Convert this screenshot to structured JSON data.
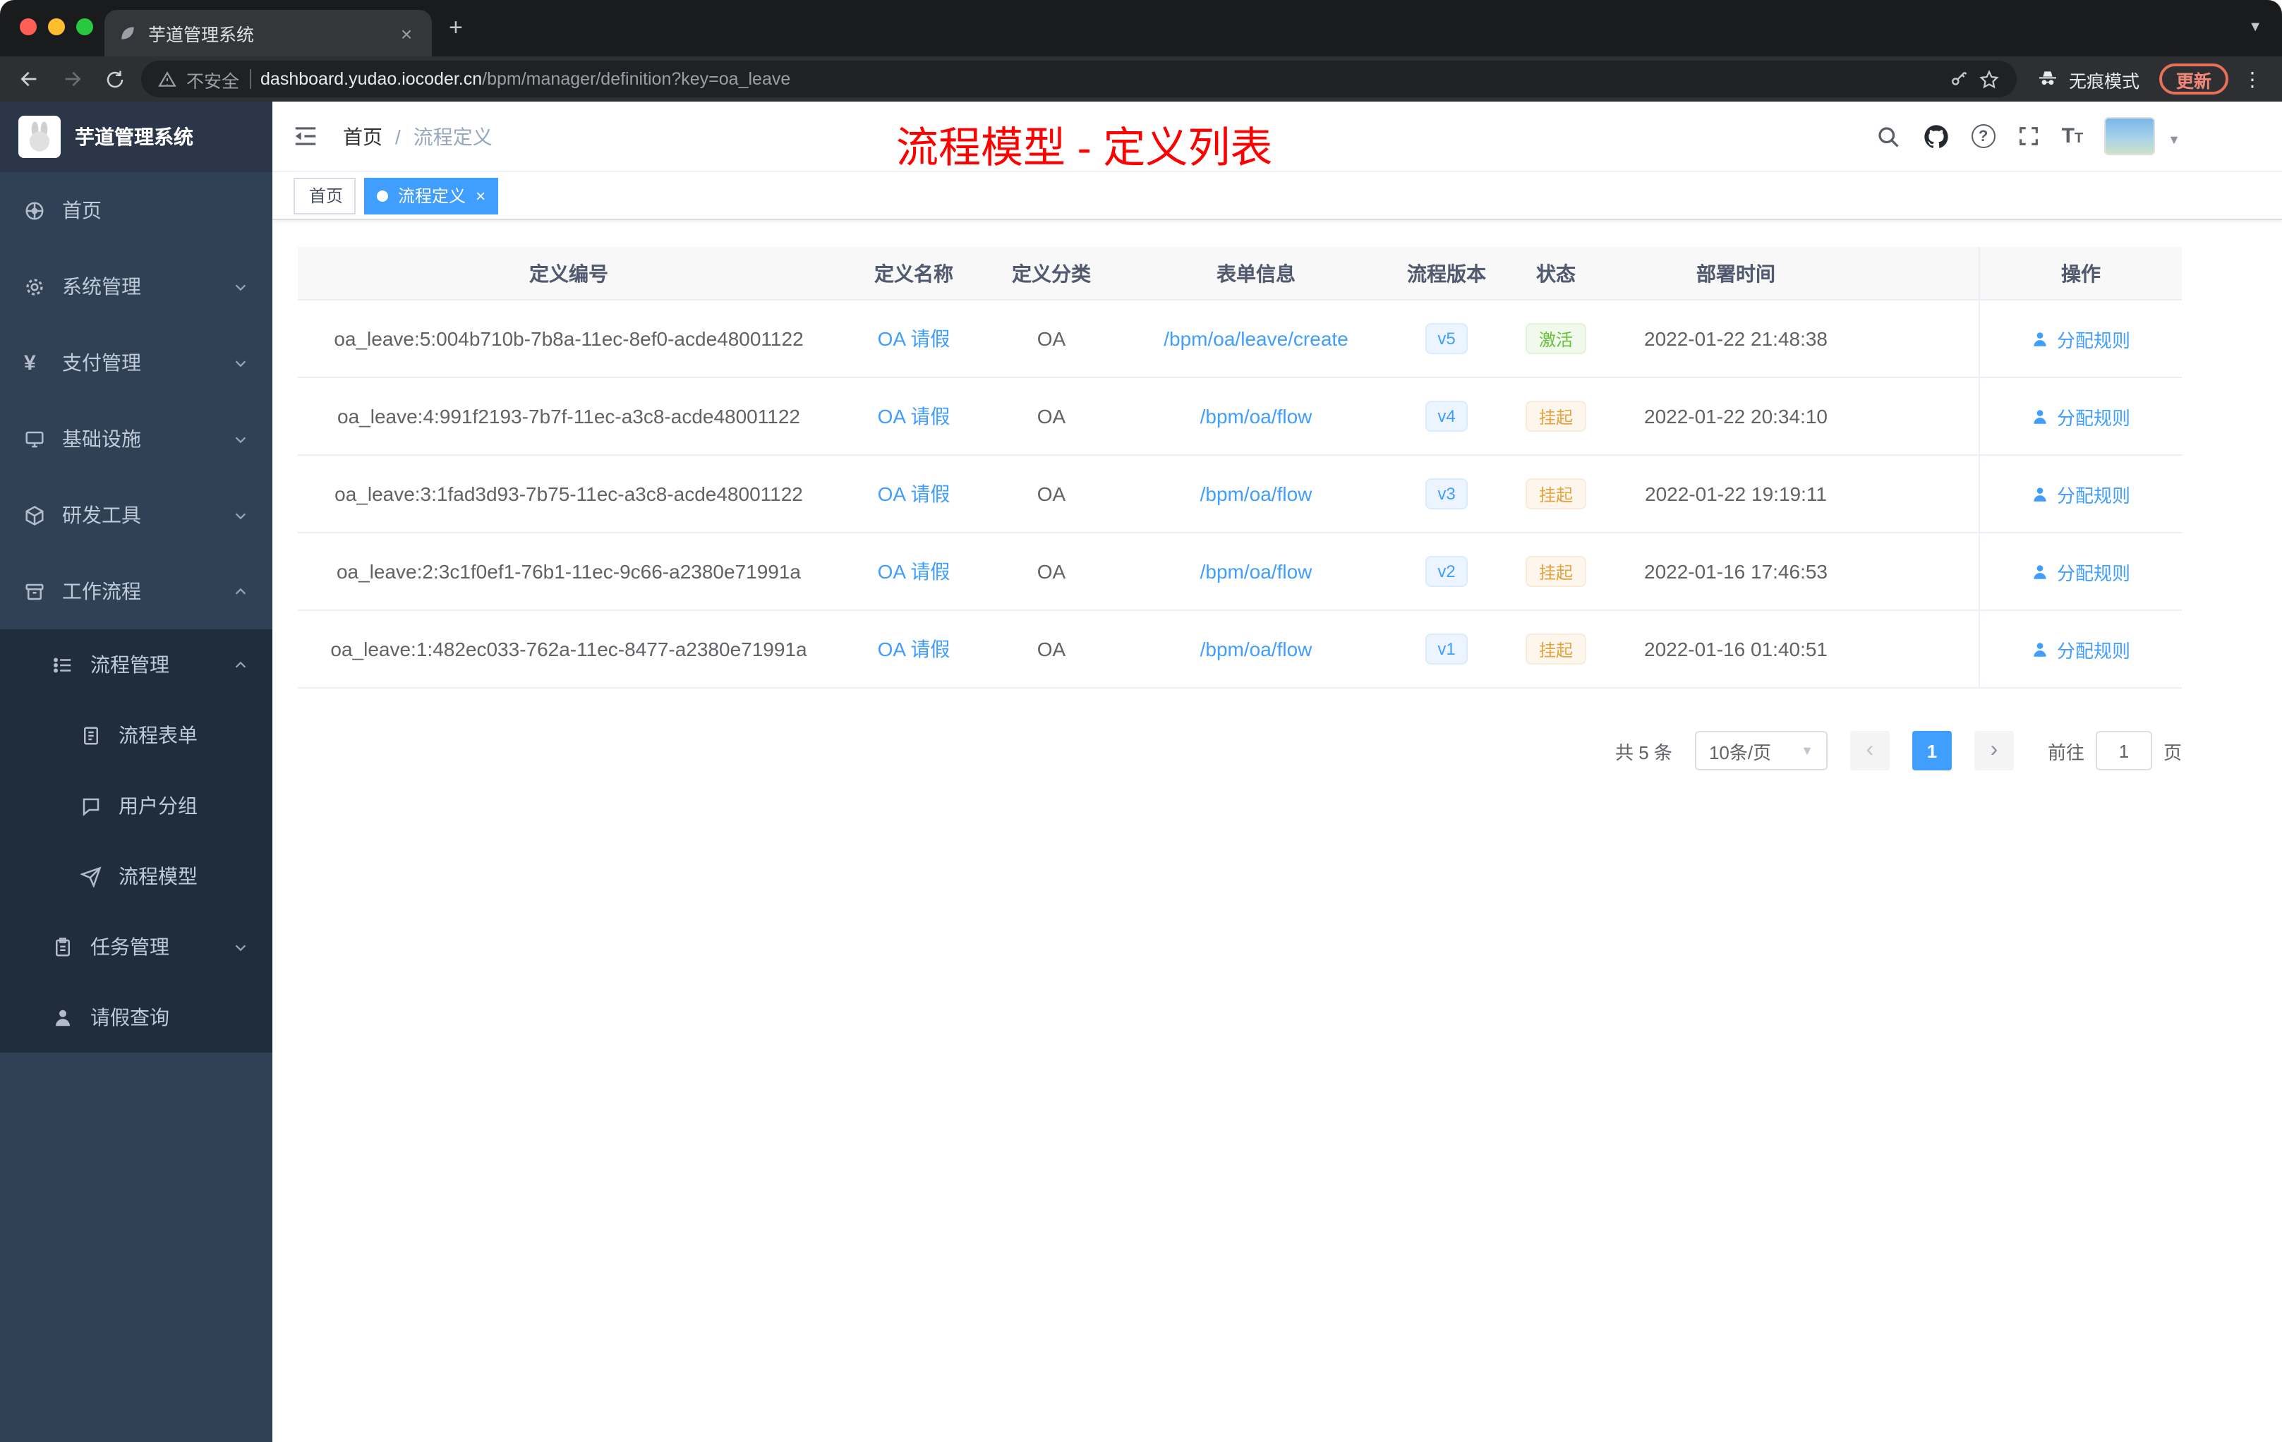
{
  "browser": {
    "tab_title": "芋道管理系统",
    "security_label": "不安全",
    "url_host": "dashboard.yudao.iocoder.cn",
    "url_path": "/bpm/manager/definition?key=oa_leave",
    "incognito_label": "无痕模式",
    "update_label": "更新"
  },
  "sidebar": {
    "logo_text": "芋道管理系统",
    "items": [
      "首页",
      "系统管理",
      "支付管理",
      "基础设施",
      "研发工具",
      "工作流程",
      "流程管理",
      "流程表单",
      "用户分组",
      "流程模型",
      "任务管理",
      "请假查询"
    ]
  },
  "header": {
    "breadcrumb": [
      "首页",
      "流程定义"
    ],
    "breadcrumb_separator": "/",
    "annotation": "流程模型 - 定义列表"
  },
  "tags": {
    "home": "首页",
    "active": "流程定义"
  },
  "table": {
    "columns": [
      "定义编号",
      "定义名称",
      "定义分类",
      "表单信息",
      "流程版本",
      "状态",
      "部署时间",
      "操作"
    ],
    "rows": [
      {
        "id": "oa_leave:5:004b710b-7b8a-11ec-8ef0-acde48001122",
        "name": "OA 请假",
        "category": "OA",
        "form": "/bpm/oa/leave/create",
        "version": "v5",
        "status": "激活",
        "status_type": "success",
        "time": "2022-01-22 21:48:38",
        "action": "分配规则"
      },
      {
        "id": "oa_leave:4:991f2193-7b7f-11ec-a3c8-acde48001122",
        "name": "OA 请假",
        "category": "OA",
        "form": "/bpm/oa/flow",
        "version": "v4",
        "status": "挂起",
        "status_type": "warning",
        "time": "2022-01-22 20:34:10",
        "action": "分配规则"
      },
      {
        "id": "oa_leave:3:1fad3d93-7b75-11ec-a3c8-acde48001122",
        "name": "OA 请假",
        "category": "OA",
        "form": "/bpm/oa/flow",
        "version": "v3",
        "status": "挂起",
        "status_type": "warning",
        "time": "2022-01-22 19:19:11",
        "action": "分配规则"
      },
      {
        "id": "oa_leave:2:3c1f0ef1-76b1-11ec-9c66-a2380e71991a",
        "name": "OA 请假",
        "category": "OA",
        "form": "/bpm/oa/flow",
        "version": "v2",
        "status": "挂起",
        "status_type": "warning",
        "time": "2022-01-16 17:46:53",
        "action": "分配规则"
      },
      {
        "id": "oa_leave:1:482ec033-762a-11ec-8477-a2380e71991a",
        "name": "OA 请假",
        "category": "OA",
        "form": "/bpm/oa/flow",
        "version": "v1",
        "status": "挂起",
        "status_type": "warning",
        "time": "2022-01-16 01:40:51",
        "action": "分配规则"
      }
    ]
  },
  "pagination": {
    "total": "共 5 条",
    "page_size": "10条/页",
    "current_page": "1",
    "goto_prefix": "前往",
    "goto_value": "1",
    "goto_suffix": "页"
  }
}
